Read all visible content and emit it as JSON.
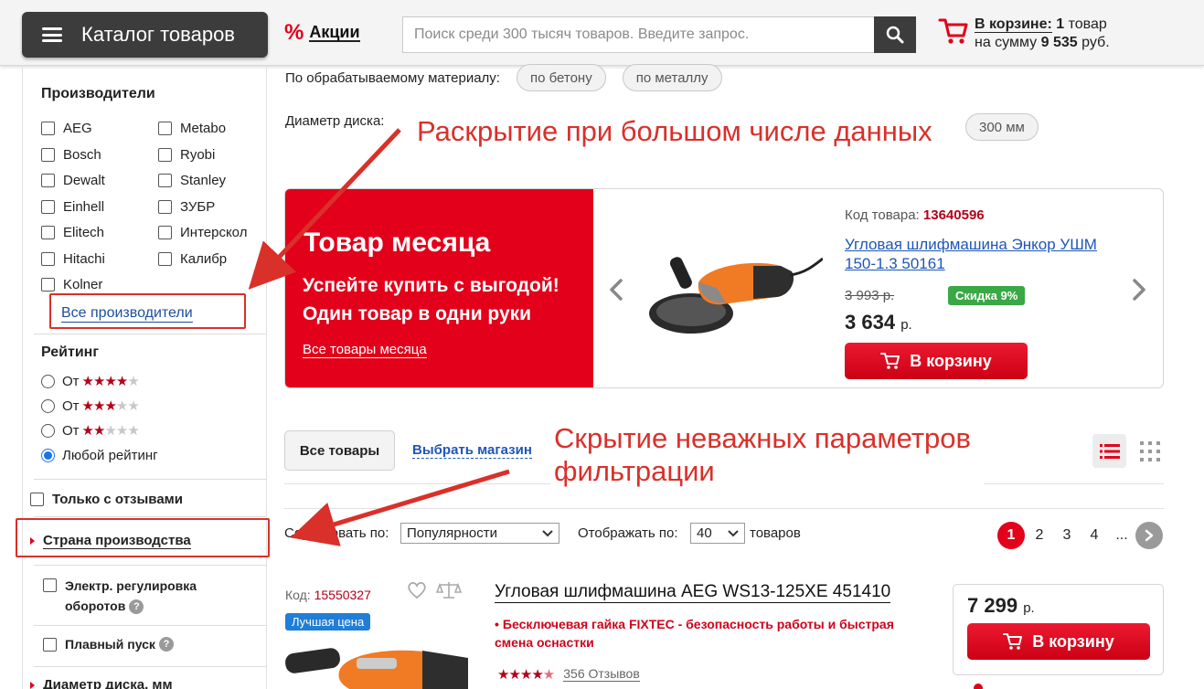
{
  "header": {
    "catalog_label": "Каталог товаров",
    "promo_label": "Акции",
    "search_placeholder": "Поиск среди 300 тысяч товаров. Введите запрос.",
    "cart": {
      "title": "В корзине:",
      "count": "1",
      "count_unit": "товар",
      "sum_prefix": "на сумму",
      "sum": "9 535",
      "currency": "руб."
    }
  },
  "sidebar": {
    "brands_title": "Производители",
    "brands_left": [
      "AEG",
      "Bosch",
      "Dewalt",
      "Einhell",
      "Elitech",
      "Hitachi",
      "Kolner"
    ],
    "brands_right": [
      "Metabo",
      "Ryobi",
      "Stanley",
      "ЗУБР",
      "Интерскол",
      "Калибр"
    ],
    "all_brands_link": "Все производители",
    "rating_title": "Рейтинг",
    "rating_options": [
      {
        "label": "От",
        "stars": 4
      },
      {
        "label": "От",
        "stars": 3
      },
      {
        "label": "От",
        "stars": 2
      },
      {
        "label": "Любой рейтинг",
        "stars": 0,
        "selected": true
      }
    ],
    "only_reviews": "Только с отзывами",
    "country": "Страна производства",
    "speed_control_1": "Электр. регулировка",
    "speed_control_2": "оборотов",
    "soft_start": "Плавный пуск",
    "disc_diameter": "Диаметр диска, мм"
  },
  "filters": {
    "material_label": "По обрабатываемому материалу:",
    "material_chips": [
      "по бетону",
      "по металлу"
    ],
    "diameter_label": "Диаметр диска:",
    "diameter_chip": "300 мм"
  },
  "product_of_month": {
    "title": "Товар месяца",
    "subtitle": "Успейте купить с выгодой! Один товар в одни руки",
    "all_link": "Все товары месяца",
    "code_label": "Код товара:",
    "code": "13640596",
    "name": "Угловая шлифмашина Энкор УШМ 150-1.3 50161",
    "old_price": "3 993 р.",
    "discount": "Скидка 9%",
    "price": "3 634",
    "currency": "р.",
    "buy_label": "В корзину"
  },
  "tabs": {
    "all_goods": "Все товары",
    "choose_store": "Выбрать магазин"
  },
  "sorting": {
    "sort_label": "Сортировать по:",
    "sort_value": "Популярности",
    "show_label": "Отображать по:",
    "show_value": "40",
    "show_unit": "товаров",
    "pages": [
      "1",
      "2",
      "3",
      "4",
      "..."
    ]
  },
  "item": {
    "code_label": "Код:",
    "code": "15550327",
    "badge": "Лучшая цена",
    "title": "Угловая шлифмашина AEG WS13-125XE 451410",
    "feature": "Бесключевая гайка FIXTEC - безопасность работы и быстрая смена оснастки",
    "reviews": "356 Отзывов",
    "price": "7 299",
    "currency": "р.",
    "buy_label": "В корзину"
  },
  "annotations": {
    "expand": "Раскрытие при большом числе данных",
    "hide_1": "Скрытие неважных параметров",
    "hide_2": "фильтрации"
  },
  "colors": {
    "accent_red": "#e2001a",
    "link_blue": "#1d56b8",
    "annotation_red": "#d9302a",
    "discount_green": "#3aa845"
  }
}
